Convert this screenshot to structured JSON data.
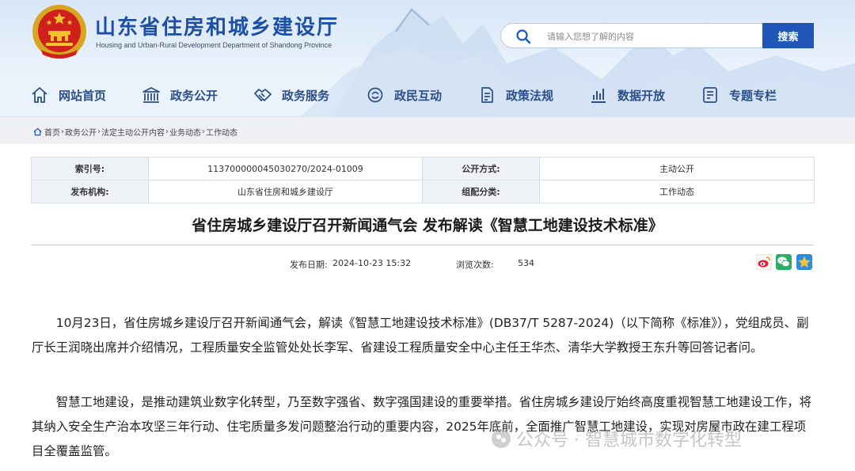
{
  "header": {
    "site_title": "山东省住房和城乡建设厅",
    "site_subtitle": "Housing and Urban-Rural Development Department of Shandong Province",
    "emblem_icon": "national-emblem",
    "search": {
      "placeholder": "请输入您想了解的内容",
      "value": "",
      "button_label": "搜索"
    },
    "accent_color": "#1f56b8"
  },
  "nav": {
    "items": [
      {
        "label": "网站首页",
        "icon": "home-icon"
      },
      {
        "label": "政务公开",
        "icon": "government-building-icon"
      },
      {
        "label": "政务服务",
        "icon": "handshake-icon"
      },
      {
        "label": "政民互动",
        "icon": "interaction-icon"
      },
      {
        "label": "政策法规",
        "icon": "document-icon"
      },
      {
        "label": "数据开放",
        "icon": "bar-chart-icon"
      },
      {
        "label": "专题专栏",
        "icon": "column-icon"
      }
    ]
  },
  "breadcrumb": {
    "items": [
      "首页",
      "政务公开",
      "法定主动公开内容",
      "业务动态",
      "工作动态"
    ],
    "separator": "›"
  },
  "meta": {
    "index_label": "索引号:",
    "index_value": "113700000045030270/2024-01009",
    "disclosure_label": "公开方式:",
    "disclosure_value": "主动公开",
    "publisher_label": "发布机构:",
    "publisher_value": "山东省住房和城乡建设厅",
    "category_label": "组配分类:",
    "category_value": "工作动态"
  },
  "article": {
    "title": "省住房城乡建设厅召开新闻通气会 发布解读《智慧工地建设技术标准》",
    "date_label": "发布日期:",
    "date_value": "2024-10-23 15:32",
    "views_label": "浏览次数:",
    "views_value": "534",
    "share_icons": [
      "weibo-icon",
      "wechat-icon",
      "qzone-icon"
    ],
    "paragraphs": [
      "10月23日，省住房城乡建设厅召开新闻通气会，解读《智慧工地建设技术标准》(DB37/T 5287-2024)（以下简称《标准》），党组成员、副厅长王润晓出席并介绍情况，工程质量安全监管处处长李军、省建设工程质量安全中心主任王华杰、清华大学教授王东升等回答记者问。",
      "智慧工地建设，是推动建筑业数字化转型，乃至数字强省、数字强国建设的重要举措。省住房城乡建设厅始终高度重视智慧工地建设工作，将其纳入安全生产治本攻坚三年行动、住宅质量多发问题整治行动的重要内容，2025年底前，全面推广智慧工地建设，实现对房屋市政在建工程项目全覆盖监管。"
    ]
  },
  "watermark": {
    "text": "公众号 · 智慧城市数字化转型"
  }
}
